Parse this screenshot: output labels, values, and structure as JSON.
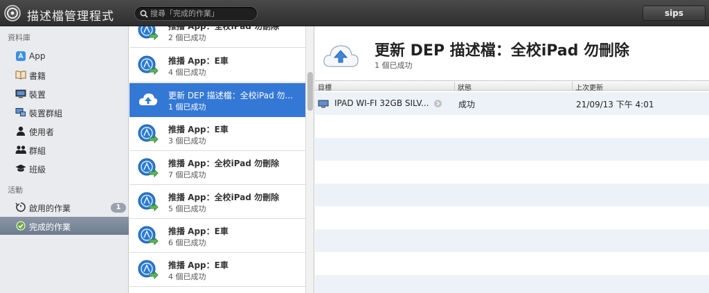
{
  "app": {
    "title": "描述檔管理程式",
    "user": "sips"
  },
  "search": {
    "placeholder": "搜尋「完成的作業」"
  },
  "sidebar": {
    "library_header": "資料庫",
    "library": [
      {
        "label": "App",
        "icon": "app-store-icon"
      },
      {
        "label": "書籍",
        "icon": "book-icon"
      },
      {
        "label": "裝置",
        "icon": "device-icon"
      },
      {
        "label": "裝置群組",
        "icon": "device-group-icon"
      },
      {
        "label": "使用者",
        "icon": "user-icon"
      },
      {
        "label": "群組",
        "icon": "group-icon"
      },
      {
        "label": "班級",
        "icon": "class-icon"
      }
    ],
    "activity_header": "活動",
    "activity": [
      {
        "label": "啟用的作業",
        "badge": "1",
        "icon": "active-tasks-icon"
      },
      {
        "label": "完成的作業",
        "icon": "completed-tasks-icon",
        "selected": true
      }
    ]
  },
  "task_list": [
    {
      "title": "推播 App：全校iPad 勿刪除",
      "subtitle": "2 個已成功",
      "icon": "app-push-icon"
    },
    {
      "title": "推播 App：E車",
      "subtitle": "4 個已成功",
      "icon": "app-push-icon"
    },
    {
      "title": "更新 DEP 描述檔：全校iPad 勿...",
      "subtitle": "1 個已成功",
      "icon": "cloud-upload-icon",
      "selected": true
    },
    {
      "title": "推播 App：E車",
      "subtitle": "3 個已成功",
      "icon": "app-push-icon"
    },
    {
      "title": "推播 App：全校iPad 勿刪除",
      "subtitle": "7 個已成功",
      "icon": "app-push-icon"
    },
    {
      "title": "推播 App：全校iPad 勿刪除",
      "subtitle": "5 個已成功",
      "icon": "app-push-icon"
    },
    {
      "title": "推播 App：E車",
      "subtitle": "6 個已成功",
      "icon": "app-push-icon"
    },
    {
      "title": "推播 App：E車",
      "subtitle": "4 個已成功",
      "icon": "app-push-icon"
    }
  ],
  "detail": {
    "title": "更新 DEP 描述檔：全校iPad 勿刪除",
    "subtitle": "1 個已成功",
    "columns": [
      "目標",
      "狀態",
      "上次更新"
    ],
    "rows": [
      {
        "target": "IPAD WI-FI 32GB SILV...",
        "status": "成功",
        "updated": "21/09/13 下午 4:01"
      }
    ]
  },
  "colors": {
    "selection": "#3478d6",
    "titlebar": "#3a3a3a",
    "sidebar": "#e9ebee"
  }
}
